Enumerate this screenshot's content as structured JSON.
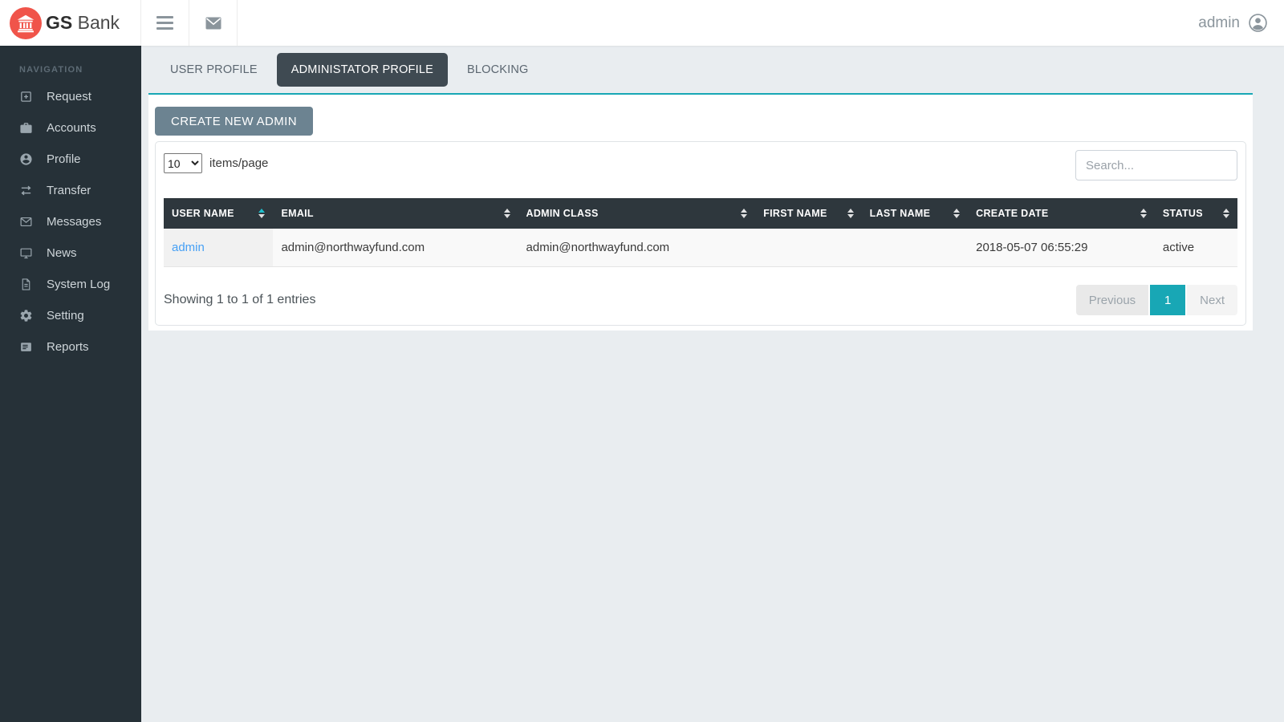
{
  "brand": {
    "bold": "GS",
    "rest": "Bank"
  },
  "header": {
    "user_label": "admin"
  },
  "sidebar": {
    "section_label": "NAVIGATION",
    "items": [
      {
        "label": "Request",
        "icon": "plus-square-icon"
      },
      {
        "label": "Accounts",
        "icon": "briefcase-icon"
      },
      {
        "label": "Profile",
        "icon": "person-circle-icon"
      },
      {
        "label": "Transfer",
        "icon": "swap-arrows-icon"
      },
      {
        "label": "Messages",
        "icon": "envelope-icon"
      },
      {
        "label": "News",
        "icon": "monitor-icon"
      },
      {
        "label": "System Log",
        "icon": "document-icon"
      },
      {
        "label": "Setting",
        "icon": "gear-icon"
      },
      {
        "label": "Reports",
        "icon": "list-box-icon"
      }
    ]
  },
  "tabs": [
    {
      "label": "USER PROFILE",
      "active": false
    },
    {
      "label": "ADMINISTATOR PROFILE",
      "active": true
    },
    {
      "label": "BLOCKING",
      "active": false
    }
  ],
  "content": {
    "create_button": "CREATE NEW ADMIN",
    "page_size": {
      "value": "10",
      "suffix": "items/page"
    },
    "search_placeholder": "Search...",
    "table": {
      "columns": [
        "USER NAME",
        "EMAIL",
        "ADMIN CLASS",
        "FIRST NAME",
        "LAST NAME",
        "CREATE DATE",
        "STATUS"
      ],
      "rows": [
        [
          "admin",
          "admin@northwayfund.com",
          "admin@northwayfund.com",
          "",
          "",
          "2018-05-07 06:55:29",
          "active"
        ]
      ]
    },
    "footer": {
      "summary": "Showing 1 to 1 of 1 entries",
      "pagination": {
        "previous": "Previous",
        "page": "1",
        "next": "Next"
      }
    }
  },
  "colors": {
    "accent_teal": "#18a7b5",
    "sidebar_bg": "#263138",
    "table_header_bg": "#2e373d",
    "active_tab_bg": "#3f4a52",
    "create_button_bg": "#6c8391",
    "brand_red": "#f0544a",
    "link_blue": "#46a0f5"
  }
}
